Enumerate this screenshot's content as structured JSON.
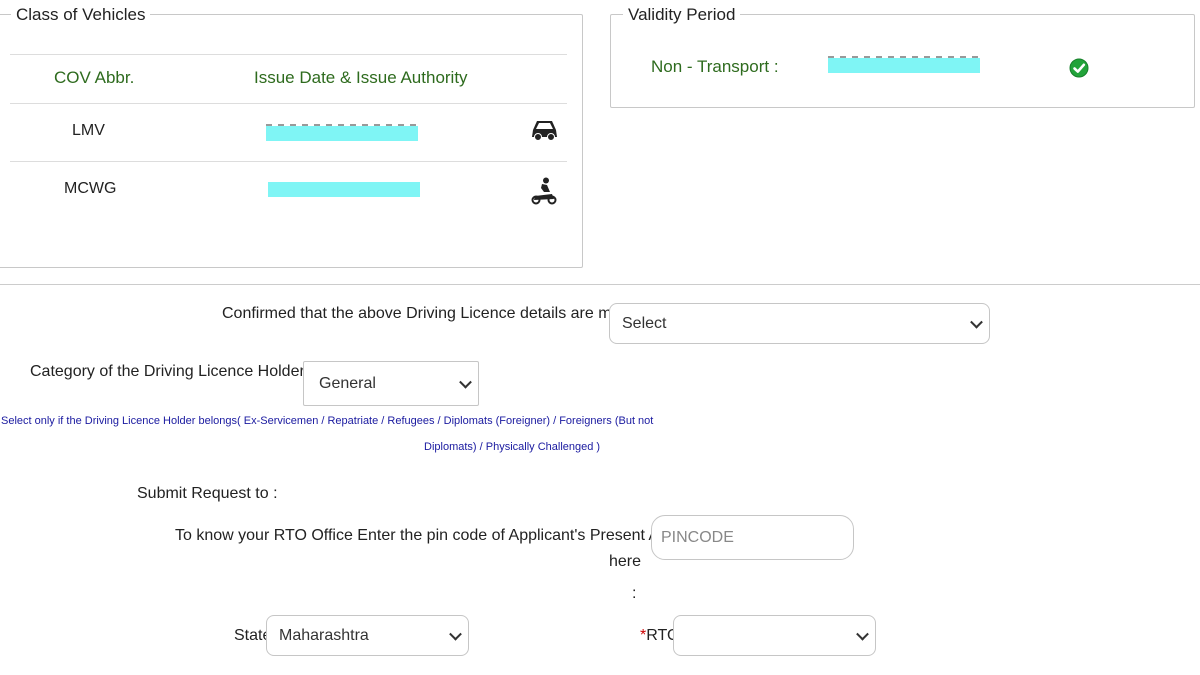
{
  "class_of_vehicles": {
    "legend": "Class of Vehicles",
    "headers": {
      "cov_abbr": "COV Abbr.",
      "issue": "Issue Date & Issue Authority"
    },
    "rows": [
      {
        "cov": "LMV",
        "icon": "car-icon"
      },
      {
        "cov": "MCWG",
        "icon": "motorcycle-icon"
      }
    ]
  },
  "validity_period": {
    "legend": "Validity Period",
    "label": "Non - Transport :",
    "status_icon": "check-circle-icon",
    "status_color": "#22a33a"
  },
  "form": {
    "confirm_label": "Confirmed that the above Driving Licence details are mine:",
    "confirm_value": "Select",
    "category_label": "Category of the Driving Licence Holder :",
    "category_value": "General",
    "category_note_line1": "Select only if the Driving Licence Holder belongs( Ex-Servicemen / Repatriate / Refugees / Diplomats (Foreigner) / Foreigners (But not",
    "category_note_line2": "Diplomats) / Physically Challenged )",
    "submit_label": "Submit Request to :",
    "pin_label_line1": "To know your RTO Office Enter the pin code of Applicant's Present Address",
    "pin_label_line2": "here",
    "pin_label_line3": ":",
    "pin_placeholder": "PINCODE",
    "state_label": "State",
    "state_value": "Maharashtra",
    "rto_required_mark": "*",
    "rto_label": "RTO",
    "rto_value": ""
  },
  "colors": {
    "header_green": "#2e6b1e",
    "note_blue": "#1a1aa0",
    "redaction": "#7ff5f5"
  }
}
